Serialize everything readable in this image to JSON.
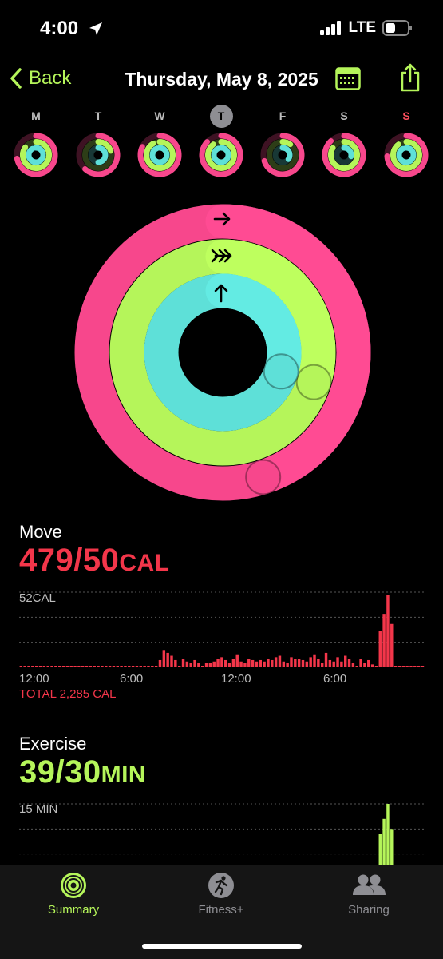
{
  "status": {
    "time": "4:00",
    "network": "LTE"
  },
  "nav": {
    "back_label": "Back",
    "title": "Thursday, May 8, 2025"
  },
  "week": [
    {
      "label": "M",
      "move": 0.72,
      "exercise": 0.85,
      "stand": 0.92
    },
    {
      "label": "T",
      "move": 0.62,
      "exercise": 0.2,
      "stand": 0.5
    },
    {
      "label": "W",
      "move": 0.82,
      "exercise": 0.92,
      "stand": 0.94
    },
    {
      "label": "T",
      "move": 0.87,
      "exercise": 0.9,
      "stand": 0.93,
      "today": true
    },
    {
      "label": "F",
      "move": 0.7,
      "exercise": 0.1,
      "stand": 0.35
    },
    {
      "label": "S",
      "move": 0.88,
      "exercise": 0.84,
      "stand": 0.28
    },
    {
      "label": "S",
      "move": 0.74,
      "exercise": 0.9,
      "stand": 0.92
    }
  ],
  "rings": {
    "move_fraction": 1.45,
    "exercise_fraction": 1.3,
    "stand_fraction": 1.3,
    "colors": {
      "move": "#f7478c",
      "exercise": "#b5f55a",
      "stand": "#5ee0d8"
    }
  },
  "move": {
    "title": "Move",
    "value": "479/50",
    "unit": "CAL",
    "chart_max_label": "52CAL",
    "x_labels": [
      "12:00",
      "6:00",
      "12:00",
      "6:00"
    ],
    "total_label": "TOTAL 2,285 CAL",
    "color": "#f3364a",
    "chart_data": {
      "type": "bar",
      "ylim": [
        0,
        52
      ],
      "values": [
        1,
        1,
        1,
        1,
        1,
        1,
        1,
        1,
        1,
        1,
        1,
        1,
        1,
        1,
        1,
        1,
        1,
        1,
        1,
        1,
        1,
        1,
        1,
        1,
        1,
        1,
        1,
        1,
        1,
        1,
        1,
        1,
        1,
        1,
        1,
        1,
        5,
        12,
        10,
        8,
        5,
        1,
        6,
        4,
        3,
        5,
        3,
        1,
        3,
        3,
        4,
        6,
        7,
        5,
        3,
        6,
        9,
        4,
        3,
        6,
        5,
        4,
        5,
        4,
        6,
        5,
        7,
        8,
        4,
        3,
        7,
        6,
        6,
        5,
        4,
        7,
        9,
        6,
        3,
        10,
        5,
        4,
        7,
        4,
        8,
        6,
        3,
        1,
        6,
        3,
        5,
        2,
        1,
        25,
        37,
        50,
        30,
        1,
        1,
        1,
        1,
        1,
        1,
        1,
        1
      ]
    }
  },
  "exercise": {
    "title": "Exercise",
    "value": "39/30",
    "unit": "MIN",
    "chart_max_label": "15 MIN",
    "color": "#b5f55a",
    "chart_data": {
      "type": "bar",
      "ylim": [
        0,
        15
      ],
      "values": [
        0,
        0,
        0,
        0,
        0,
        0,
        0,
        0,
        0,
        0,
        0,
        0,
        0,
        0,
        0,
        0,
        0,
        0,
        0,
        0,
        0,
        0,
        0,
        0,
        0,
        0,
        0,
        0,
        0,
        0,
        0,
        0,
        0,
        0,
        0,
        0,
        0,
        0,
        0,
        0,
        0,
        0,
        0,
        0,
        0,
        0,
        0,
        0,
        0,
        0,
        0,
        0,
        0,
        0,
        0,
        0,
        0,
        0,
        0,
        0,
        0,
        0,
        0,
        0,
        0,
        0,
        0,
        0,
        0,
        0,
        0,
        0,
        0,
        0,
        0,
        0,
        0,
        0,
        0,
        0,
        0,
        0,
        0,
        0,
        0,
        0,
        0,
        0,
        0,
        0,
        0,
        0,
        0,
        9,
        12,
        15,
        10,
        0,
        0,
        0,
        0,
        0,
        0,
        0,
        0
      ]
    }
  },
  "tabs": [
    {
      "label": "Summary",
      "active": true
    },
    {
      "label": "Fitness+",
      "active": false
    },
    {
      "label": "Sharing",
      "active": false
    }
  ]
}
